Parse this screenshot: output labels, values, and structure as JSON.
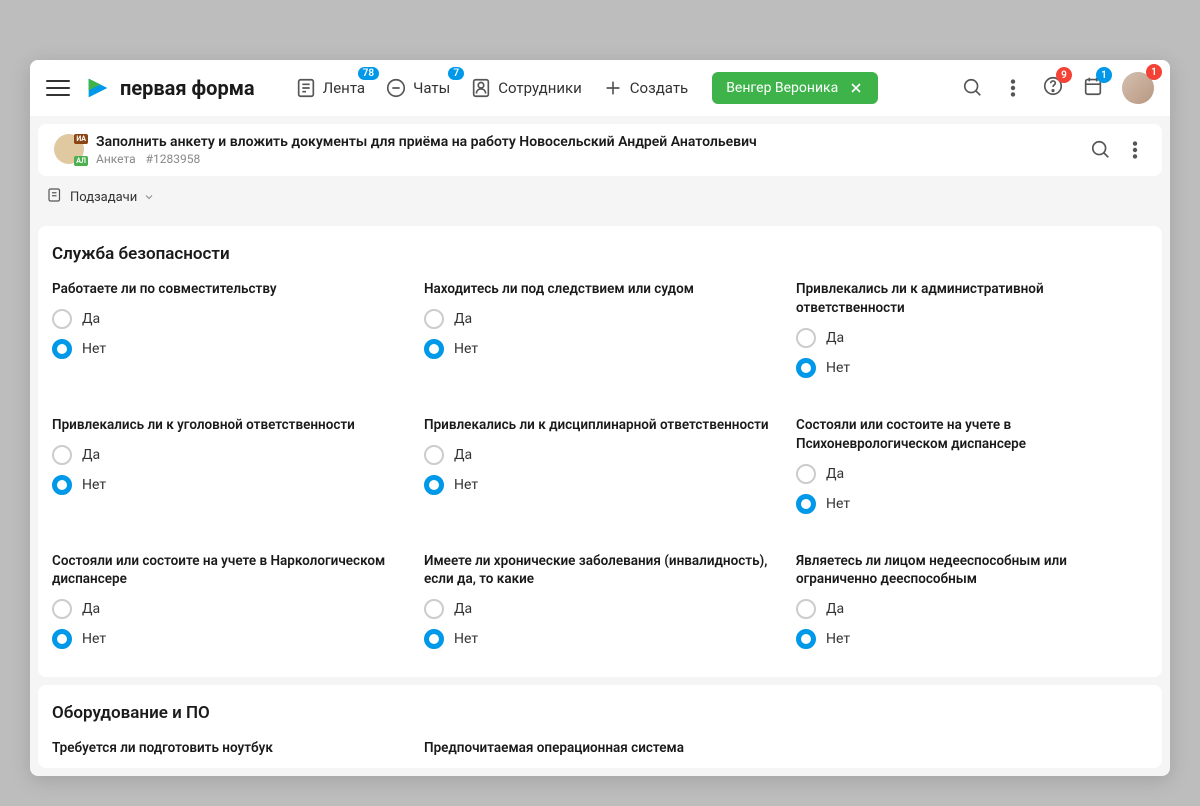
{
  "header": {
    "logo_text": "первая форма",
    "nav": {
      "feed": {
        "label": "Лента",
        "badge": "78"
      },
      "chats": {
        "label": "Чаты",
        "badge": "7"
      },
      "employees": {
        "label": "Сотрудники"
      },
      "create": {
        "label": "Создать"
      }
    },
    "chip": {
      "label": "Венгер Вероника"
    },
    "badges": {
      "help": "9",
      "calendar": "1",
      "avatar": "1"
    }
  },
  "task": {
    "title": "Заполнить анкету и вложить документы для приёма на работу Новосельский Андрей Анатольевич",
    "category": "Анкета",
    "id": "#1283958",
    "tags": {
      "t1": "ИА",
      "t2": "АЛ"
    }
  },
  "subtasks": {
    "label": "Подзадачи"
  },
  "section1": {
    "title": "Служба безопасности",
    "questions": [
      {
        "label": "Работаете ли по совместительству",
        "yes": "Да",
        "no": "Нет",
        "selected": "no"
      },
      {
        "label": "Находитесь ли под следствием или судом",
        "yes": "Да",
        "no": "Нет",
        "selected": "no"
      },
      {
        "label": "Привлекались ли к административной ответственности",
        "yes": "Да",
        "no": "Нет",
        "selected": "no"
      },
      {
        "label": "Привлекались ли к уголовной ответственности",
        "yes": "Да",
        "no": "Нет",
        "selected": "no"
      },
      {
        "label": "Привлекались ли к дисциплинарной ответственности",
        "yes": "Да",
        "no": "Нет",
        "selected": "no"
      },
      {
        "label": "Состояли или состоите на учете в Психоневрологическом диспансере",
        "yes": "Да",
        "no": "Нет",
        "selected": "no"
      },
      {
        "label": "Состояли или состоите на учете в Наркологическом диспансере",
        "yes": "Да",
        "no": "Нет",
        "selected": "no"
      },
      {
        "label": "Имеете ли хронические заболевания (инвалидность), если да, то какие",
        "yes": "Да",
        "no": "Нет",
        "selected": "no"
      },
      {
        "label": "Являетесь ли лицом недееспособным или ограниченно дееспособным",
        "yes": "Да",
        "no": "Нет",
        "selected": "no"
      }
    ]
  },
  "section2": {
    "title": "Оборудование и ПО",
    "questions": [
      {
        "label": "Требуется ли подготовить ноутбук"
      },
      {
        "label": "Предпочитаемая операционная система"
      }
    ]
  }
}
